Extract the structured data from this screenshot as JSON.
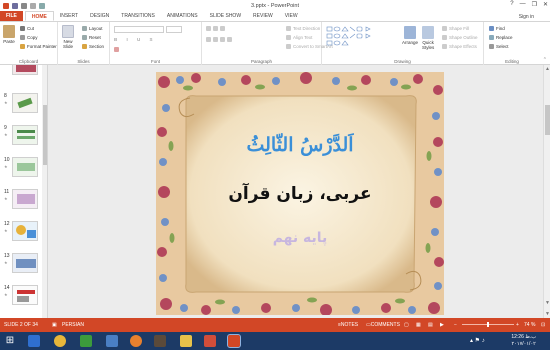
{
  "window": {
    "title": "3.pptx - PowerPoint",
    "signin": "Sign in",
    "controls": [
      "?",
      "—",
      "❐",
      "✕"
    ]
  },
  "tabs": [
    "FILE",
    "HOME",
    "INSERT",
    "DESIGN",
    "TRANSITIONS",
    "ANIMATIONS",
    "SLIDE SHOW",
    "REVIEW",
    "VIEW"
  ],
  "ribbon": {
    "clipboard": {
      "paste": "Paste",
      "cut": "Cut",
      "copy": "Copy",
      "format_painter": "Format Painter",
      "label": "Clipboard"
    },
    "slides": {
      "new_slide_line1": "New",
      "new_slide_line2": "Slide",
      "layout": "Layout",
      "reset": "Reset",
      "section": "Section",
      "label": "Slides"
    },
    "font": {
      "label": "Font"
    },
    "paragraph": {
      "text_direction": "Text Direction",
      "align_text": "Align Text",
      "convert_smartart": "Convert to SmartArt",
      "label": "Paragraph"
    },
    "drawing": {
      "arrange": "Arrange",
      "quick_styles_line1": "Quick",
      "quick_styles_line2": "Styles",
      "shape_fill": "Shape Fill",
      "shape_outline": "Shape Outline",
      "shape_effects": "Shape Effects",
      "label": "Drawing"
    },
    "editing": {
      "find": "Find",
      "replace": "Replace",
      "select": "Select",
      "label": "Editing"
    }
  },
  "thumbnails": [
    {
      "num": "8"
    },
    {
      "num": "9"
    },
    {
      "num": "10"
    },
    {
      "num": "11"
    },
    {
      "num": "12"
    },
    {
      "num": "13"
    },
    {
      "num": "14"
    }
  ],
  "slide": {
    "title": "اَلدَّرْسُ الثّالِثُ",
    "subtitle": "عربی، زبان قرآن",
    "grade": "پایه نهم"
  },
  "status": {
    "slide_info": "SLIDE 2 OF 34",
    "language": "PERSIAN",
    "notes": "NOTES",
    "comments": "COMMENTS",
    "zoom": "74 %"
  },
  "clock": {
    "time": "12:26 ب.ظ",
    "date": "۲۰۱۷/۰۱/۰۲"
  },
  "colors": {
    "accent": "#d24726",
    "taskbar": "#1c3a66",
    "title_blue": "#3a8fd8",
    "grade_purple": "#c7b6df"
  }
}
